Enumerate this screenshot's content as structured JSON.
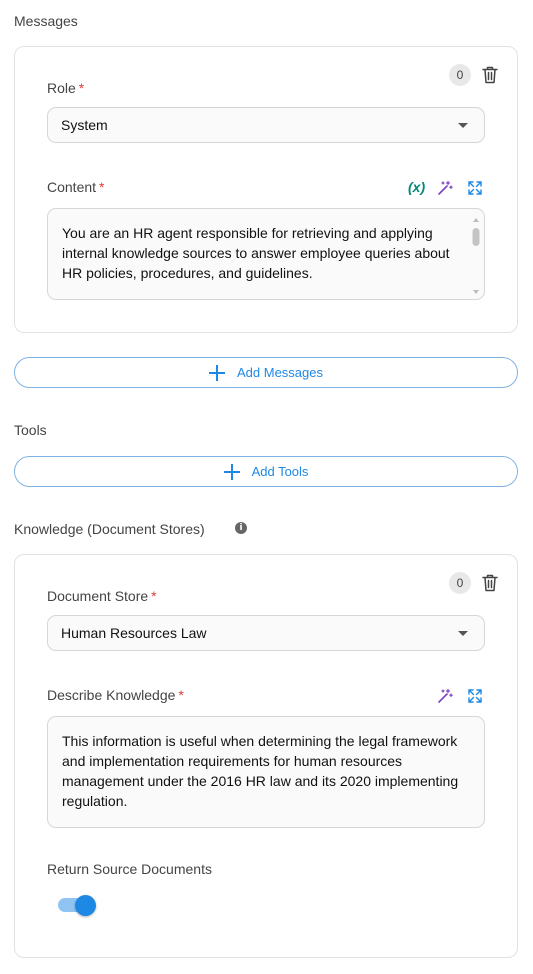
{
  "messages": {
    "section_label": "Messages",
    "count": "0",
    "role_label": "Role",
    "role_value": "System",
    "content_label": "Content",
    "variable_icon_text": "(x)",
    "content_text": "You are an HR agent responsible for retrieving and applying internal knowledge sources to answer employee queries about HR policies, procedures, and guidelines.",
    "add_label": "Add Messages"
  },
  "tools": {
    "section_label": "Tools",
    "add_label": "Add Tools"
  },
  "knowledge": {
    "section_label": "Knowledge (Document Stores)",
    "info_icon_text": "i",
    "count": "0",
    "store_label": "Document Store",
    "store_value": "Human Resources Law",
    "describe_label": "Describe Knowledge",
    "describe_text": "This information is useful when determining the legal framework and implementation requirements for human resources management under the 2016 HR law and its 2020 implementing regulation.",
    "return_label": "Return Source Documents",
    "return_enabled": true
  },
  "required_marker": "*",
  "colors": {
    "accent": "#1e88e5",
    "required": "#e53935",
    "variable": "#00897b",
    "magic": "#7b3fc4"
  },
  "icons": [
    "trash-icon",
    "variable-icon",
    "magic-wand-icon",
    "expand-icon",
    "plus-icon",
    "info-icon",
    "caret-down-icon"
  ]
}
